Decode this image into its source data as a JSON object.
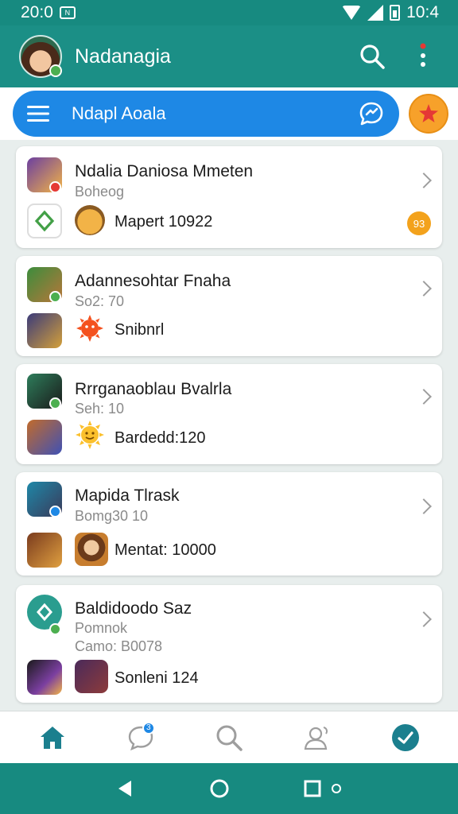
{
  "status_bar": {
    "time_left": "20:0",
    "badge_text": "N",
    "time_right": "10:4"
  },
  "app_bar": {
    "title": "Nadanagia"
  },
  "search": {
    "label": "Ndapl Aoala"
  },
  "cards": [
    {
      "title": "Ndalia Daniosa Mmeten",
      "sub": "Boheog",
      "sub2": "",
      "foot": "Mapert 10922",
      "count": "93",
      "colors": {
        "top": "#6b3fa0",
        "bottom": "#ffffff",
        "emoji": "#f2b347",
        "badge": "#e53935"
      }
    },
    {
      "title": "Adannesohtar Fnaha",
      "sub": "So2: 70",
      "sub2": "",
      "foot": "Snibnrl",
      "count": "",
      "colors": {
        "top": "#3c8d3c",
        "bottom": "#3b3b7a",
        "emoji": "#f4511e",
        "badge": "#4caf50"
      }
    },
    {
      "title": "Rrrganaoblau Bvalrla",
      "sub": "Seh: 10",
      "sub2": "",
      "foot": "Bardedd:120",
      "count": "",
      "colors": {
        "top": "#2e7d5b",
        "bottom": "#c26b2b",
        "emoji": "#fbc02d",
        "badge": "#4caf50"
      }
    },
    {
      "title": "Mapida Tlrask",
      "sub": "Bomg30 10",
      "sub2": "",
      "foot": "Mentat: 10000",
      "count": "",
      "colors": {
        "top": "#1e88a8",
        "bottom": "#7a3b1e",
        "emoji": "#c77d2e",
        "badge": "#1e88e5"
      }
    },
    {
      "title": "Baldidoodo Saz",
      "sub": "Pomnok",
      "sub2": "Camo: B0078",
      "foot": "Sonleni 124",
      "count": "",
      "colors": {
        "top": "#2a9d8f",
        "bottom": "#4a2a5a",
        "emoji": "#8d3b3b",
        "badge": "#4caf50"
      }
    }
  ],
  "bottom_nav": {
    "items": [
      "home-icon",
      "chat-icon",
      "search-icon",
      "people-icon",
      "check-icon"
    ],
    "chat_badge": "3",
    "active_color": "#1b7f8e"
  },
  "colors": {
    "primary": "#1b8f86",
    "accent": "#1e88e5",
    "fab": "#f7a12a"
  }
}
